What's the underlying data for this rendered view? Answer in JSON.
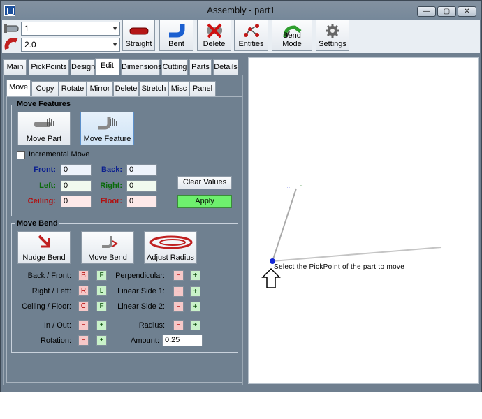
{
  "window": {
    "title": "Assembly - part1"
  },
  "titlebar_buttons": [
    "—",
    "▢",
    "✕"
  ],
  "combos": [
    {
      "value": "1"
    },
    {
      "value": "2.0"
    }
  ],
  "toolbar": [
    {
      "label": "Straight",
      "icon": "pipe-straight-icon"
    },
    {
      "label": "Bent",
      "icon": "pipe-bent-icon"
    },
    {
      "label": "Delete",
      "icon": "delete-x-icon"
    },
    {
      "label": "Entities",
      "icon": "entities-icon"
    },
    {
      "label": "Bend Mode",
      "icon": "bend-mode-icon"
    },
    {
      "label": "Settings",
      "icon": "gear-icon"
    }
  ],
  "main_tabs": [
    "Main",
    "PickPoints",
    "Design",
    "Edit",
    "Dimensions",
    "Cutting",
    "Parts",
    "Details"
  ],
  "main_tab_active": "Edit",
  "sub_tabs": [
    "Move",
    "Copy",
    "Rotate",
    "Mirror",
    "Delete",
    "Stretch",
    "Misc",
    "Panel"
  ],
  "sub_tab_active": "Move",
  "move_features": {
    "title": "Move Features",
    "move_part": "Move Part",
    "move_feature": "Move Feature",
    "incremental": "Incremental Move",
    "front": {
      "label": "Front:",
      "value": "0",
      "color": "#0b1f8f"
    },
    "back": {
      "label": "Back:",
      "value": "0",
      "color": "#0b1f8f"
    },
    "left": {
      "label": "Left:",
      "value": "0",
      "color": "#0a6a0a"
    },
    "right": {
      "label": "Right:",
      "value": "0",
      "color": "#0a6a0a"
    },
    "ceiling": {
      "label": "Ceiling:",
      "value": "0",
      "color": "#b01010"
    },
    "floor": {
      "label": "Floor:",
      "value": "0",
      "color": "#b01010"
    },
    "clear": "Clear Values",
    "apply": "Apply"
  },
  "move_bend": {
    "title": "Move Bend",
    "nudge": "Nudge Bend",
    "move": "Move Bend",
    "adjust": "Adjust Radius",
    "back_front": "Back / Front:",
    "right_left": "Right / Left:",
    "ceiling_floor": "Ceiling / Floor:",
    "in_out": "In / Out:",
    "rotation": "Rotation:",
    "perpendicular": "Perpendicular:",
    "linear1": "Linear Side 1:",
    "linear2": "Linear Side 2:",
    "radius": "Radius:",
    "amount": "Amount:",
    "amount_value": "0.25",
    "btn_b": "B",
    "btn_f": "F",
    "btn_r": "R",
    "btn_l": "L",
    "btn_c": "C",
    "btn_f2": "F",
    "minus": "−",
    "plus": "+"
  },
  "canvas": {
    "status": "Select the PickPoint of the part to move"
  }
}
